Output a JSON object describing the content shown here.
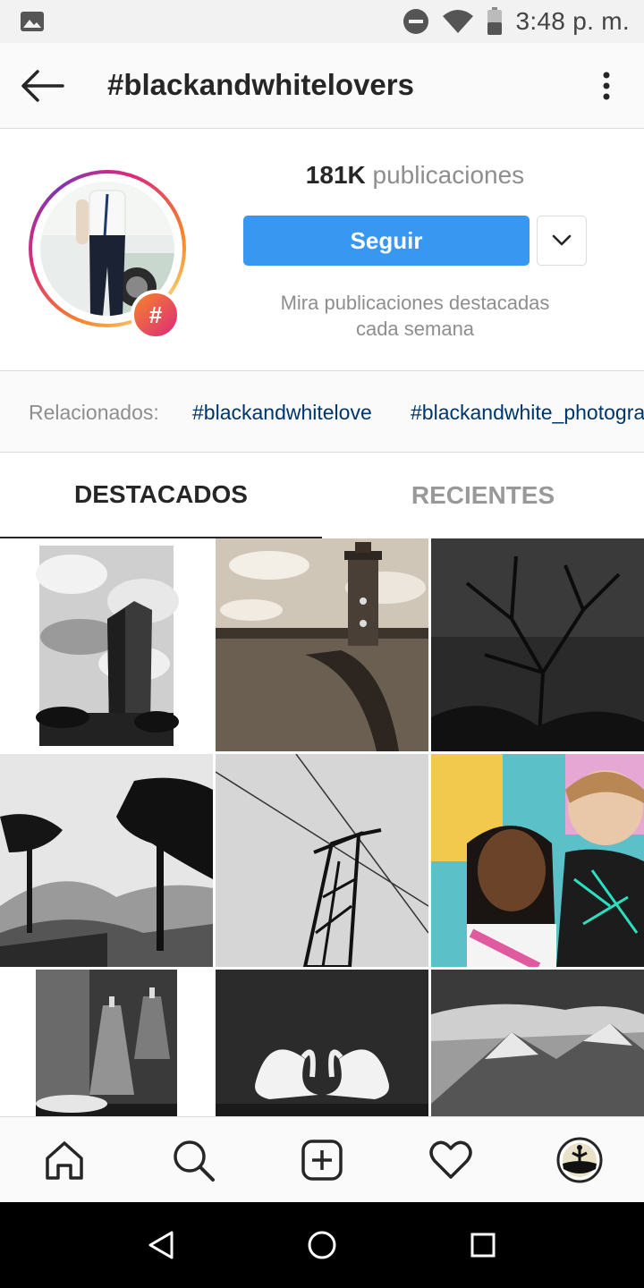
{
  "status_bar": {
    "time": "3:48 p. m.",
    "icons": [
      "image-icon",
      "do-not-disturb-icon",
      "wifi-icon",
      "battery-icon"
    ]
  },
  "header": {
    "title": "#blackandwhitelovers",
    "back_icon": "back-arrow-icon",
    "more_icon": "more-vertical-icon"
  },
  "profile": {
    "post_count": "181K",
    "post_label": "publicaciones",
    "follow_label": "Seguir",
    "hash_badge": "#",
    "subtitle_line1": "Mira publicaciones destacadas",
    "subtitle_line2": "cada semana"
  },
  "related": {
    "label": "Relacionados:",
    "tags": [
      "#blackandwhitelove",
      "#blackandwhite_photography"
    ]
  },
  "tabs": [
    {
      "label": "DESTACADOS",
      "active": true
    },
    {
      "label": "RECIENTES",
      "active": false
    }
  ],
  "grid": {
    "posts": [
      {
        "subject": "skyscraper-bw"
      },
      {
        "subject": "lighthouse-sepia"
      },
      {
        "subject": "bare-tree-dark"
      },
      {
        "subject": "pine-tree-mountains"
      },
      {
        "subject": "power-tower"
      },
      {
        "subject": "couple-selfie-color"
      },
      {
        "subject": "interior-lamps"
      },
      {
        "subject": "swans-heart"
      },
      {
        "subject": "mountain-peak"
      }
    ]
  },
  "bottom_nav": [
    "home-icon",
    "search-icon",
    "add-post-icon",
    "heart-icon",
    "profile-avatar"
  ],
  "colors": {
    "accent": "#3897f0",
    "link": "#003569",
    "muted": "#8e8e8e",
    "text": "#262626"
  }
}
